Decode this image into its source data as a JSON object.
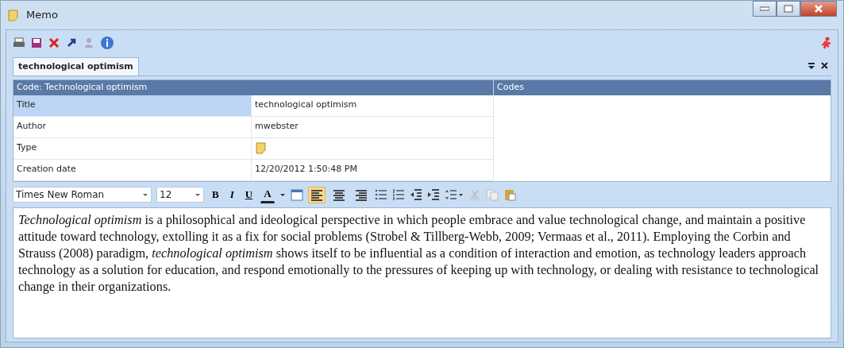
{
  "window": {
    "title": "Memo"
  },
  "tabs": [
    {
      "label": "technological optimism",
      "selected": true
    }
  ],
  "properties": {
    "header": "Code: Technological optimism",
    "codes_header": "Codes",
    "rows": [
      {
        "label": "Title",
        "value": "technological optimism",
        "kind": "text",
        "selected": true
      },
      {
        "label": "Author",
        "value": "mwebster",
        "kind": "text",
        "selected": false
      },
      {
        "label": "Type",
        "kind": "memo-icon",
        "selected": false
      },
      {
        "label": "Creation date",
        "value": "12/20/2012 1:50:48 PM",
        "kind": "text",
        "selected": false
      }
    ]
  },
  "format_bar": {
    "font": "Times New Roman",
    "size": "12",
    "styles": [
      {
        "label": "B",
        "kind": "bold"
      },
      {
        "label": "I",
        "kind": "italic"
      },
      {
        "label": "U",
        "kind": "underline"
      },
      {
        "label": "A",
        "kind": "color"
      }
    ],
    "alignment": [
      {
        "selected": true
      },
      {
        "selected": false
      },
      {
        "selected": false
      }
    ]
  },
  "body": "*Technological optimism* is a philosophical and ideological perspective in which people embrace and value technological change, and maintain a positive attitude toward technology, extolling it as a fix for social problems (Strobel & Tillberg-Webb, 2009; Vermaas et al., 2011).  Employing the Corbin and Strauss (2008) paradigm, *technological optimism* shows itself to be influential as a condition of interaction and emotion, as technology leaders approach technology as a solution for education, and respond emotionally to the pressures of keeping up with technology, or dealing with resistance to technological change in their organizations."
}
